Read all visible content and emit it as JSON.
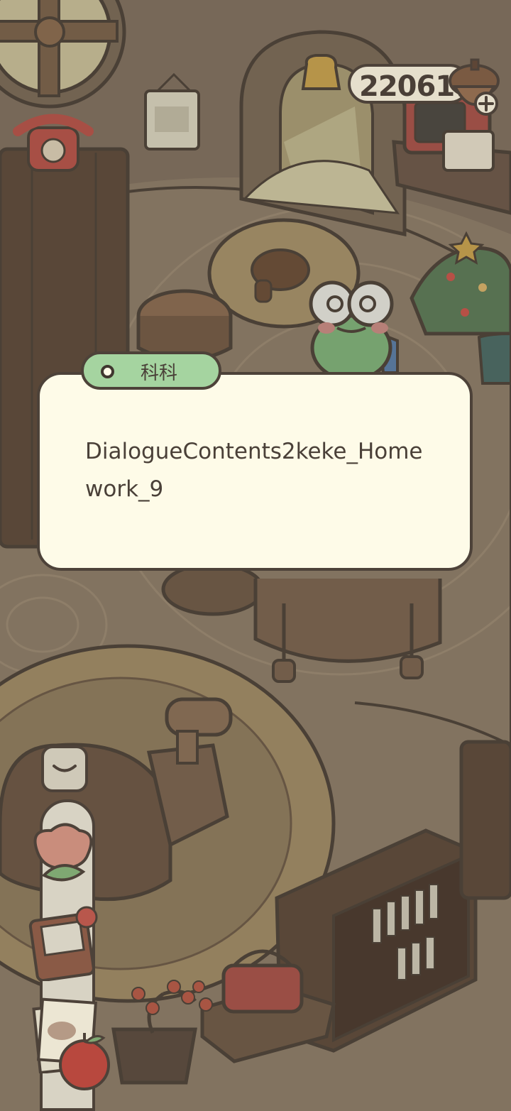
{
  "hud": {
    "currency_value": "220617",
    "add_icon": "plus-icon"
  },
  "dialogue": {
    "speaker": "科科",
    "text": "DialogueContents2keke_Homework_9"
  },
  "side_menu": {
    "collapse_icon": "chevron-down-icon",
    "items": [
      "tulip-icon",
      "notebook-icon",
      "letters-icon",
      "apple-icon"
    ]
  },
  "colors": {
    "dialogue_bg": "#fefbe8",
    "name_tag_bg": "#a5d4a0",
    "outline": "#4d4239",
    "scene_dim": "#8f7f6b"
  }
}
